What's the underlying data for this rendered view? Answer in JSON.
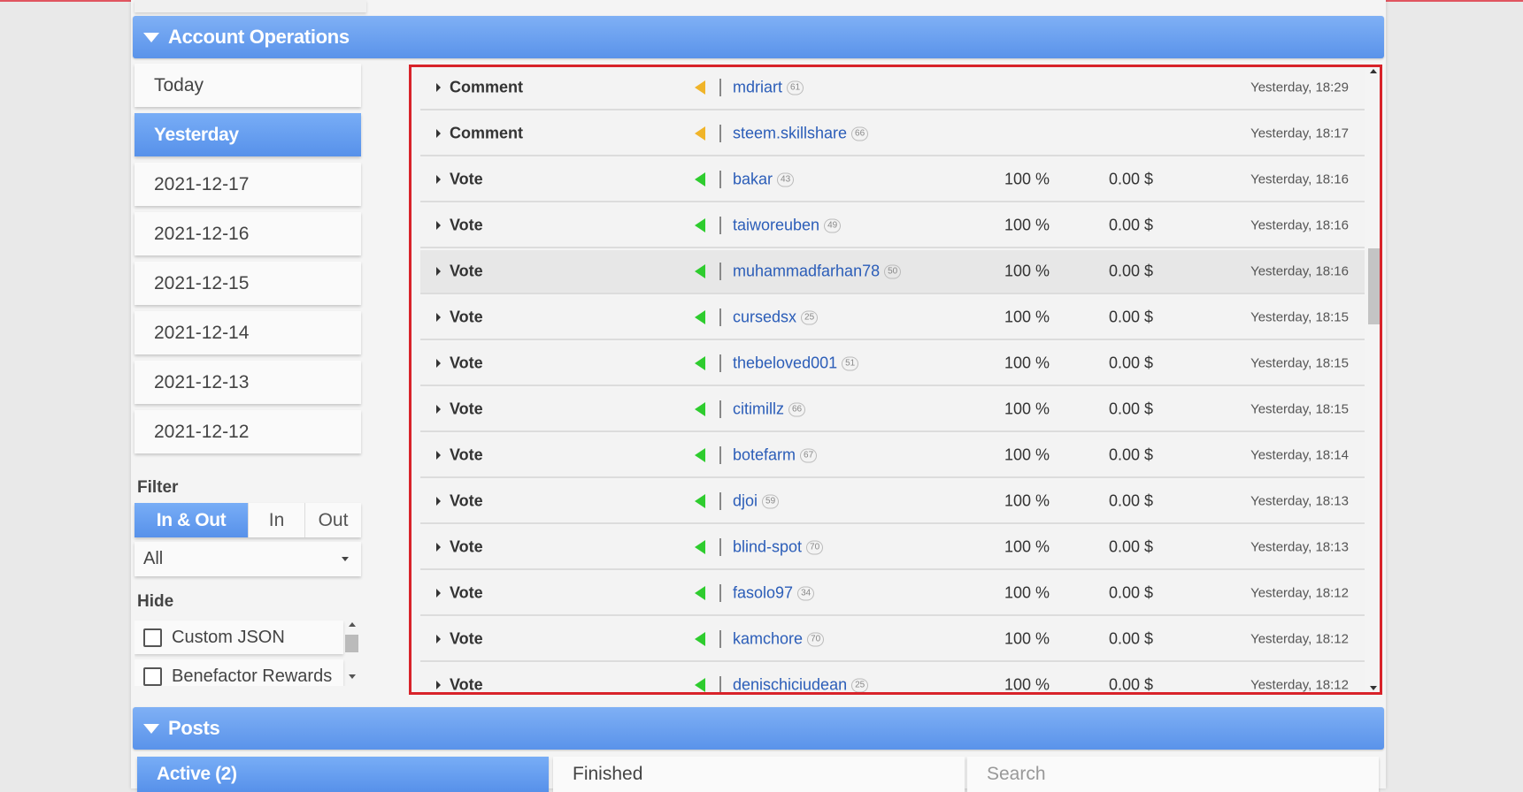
{
  "account_operations": {
    "title": "Account Operations",
    "dates": [
      "Today",
      "Yesterday",
      "2021-12-17",
      "2021-12-16",
      "2021-12-15",
      "2021-12-14",
      "2021-12-13",
      "2021-12-12"
    ],
    "active_date_index": 1,
    "filter": {
      "label": "Filter",
      "options": [
        "In & Out",
        "In",
        "Out"
      ],
      "selected": "In & Out",
      "type_select": "All"
    },
    "hide": {
      "label": "Hide",
      "items": [
        "Custom JSON",
        "Benefactor Rewards"
      ]
    },
    "operations": [
      {
        "type": "Comment",
        "direction": "out",
        "user": "mdriart",
        "rep": "61",
        "percent": "",
        "amount": "",
        "time": "Yesterday, 18:29"
      },
      {
        "type": "Comment",
        "direction": "out",
        "user": "steem.skillshare",
        "rep": "66",
        "percent": "",
        "amount": "",
        "time": "Yesterday, 18:17"
      },
      {
        "type": "Vote",
        "direction": "in",
        "user": "bakar",
        "rep": "43",
        "percent": "100 %",
        "amount": "0.00 $",
        "time": "Yesterday, 18:16"
      },
      {
        "type": "Vote",
        "direction": "in",
        "user": "taiworeuben",
        "rep": "49",
        "percent": "100 %",
        "amount": "0.00 $",
        "time": "Yesterday, 18:16"
      },
      {
        "type": "Vote",
        "direction": "in",
        "user": "muhammadfarhan78",
        "rep": "50",
        "percent": "100 %",
        "amount": "0.00 $",
        "time": "Yesterday, 18:16"
      },
      {
        "type": "Vote",
        "direction": "in",
        "user": "cursedsx",
        "rep": "25",
        "percent": "100 %",
        "amount": "0.00 $",
        "time": "Yesterday, 18:15"
      },
      {
        "type": "Vote",
        "direction": "in",
        "user": "thebeloved001",
        "rep": "51",
        "percent": "100 %",
        "amount": "0.00 $",
        "time": "Yesterday, 18:15"
      },
      {
        "type": "Vote",
        "direction": "in",
        "user": "citimillz",
        "rep": "66",
        "percent": "100 %",
        "amount": "0.00 $",
        "time": "Yesterday, 18:15"
      },
      {
        "type": "Vote",
        "direction": "in",
        "user": "botefarm",
        "rep": "67",
        "percent": "100 %",
        "amount": "0.00 $",
        "time": "Yesterday, 18:14"
      },
      {
        "type": "Vote",
        "direction": "in",
        "user": "djoi",
        "rep": "59",
        "percent": "100 %",
        "amount": "0.00 $",
        "time": "Yesterday, 18:13"
      },
      {
        "type": "Vote",
        "direction": "in",
        "user": "blind-spot",
        "rep": "70",
        "percent": "100 %",
        "amount": "0.00 $",
        "time": "Yesterday, 18:13"
      },
      {
        "type": "Vote",
        "direction": "in",
        "user": "fasolo97",
        "rep": "34",
        "percent": "100 %",
        "amount": "0.00 $",
        "time": "Yesterday, 18:12"
      },
      {
        "type": "Vote",
        "direction": "in",
        "user": "kamchore",
        "rep": "70",
        "percent": "100 %",
        "amount": "0.00 $",
        "time": "Yesterday, 18:12"
      },
      {
        "type": "Vote",
        "direction": "in",
        "user": "denischiciudean",
        "rep": "25",
        "percent": "100 %",
        "amount": "0.00 $",
        "time": "Yesterday, 18:12"
      }
    ],
    "highlighted_row_index": 4
  },
  "posts": {
    "title": "Posts",
    "tabs": [
      "Active (2)",
      "Finished"
    ],
    "search_placeholder": "Search"
  },
  "colors": {
    "accent_blue": "#5a93ea",
    "incoming_arrow": "#2ecc2e",
    "outgoing_arrow": "#f0b429",
    "username_link": "#2b5db8",
    "selection_border": "#d8232a"
  }
}
